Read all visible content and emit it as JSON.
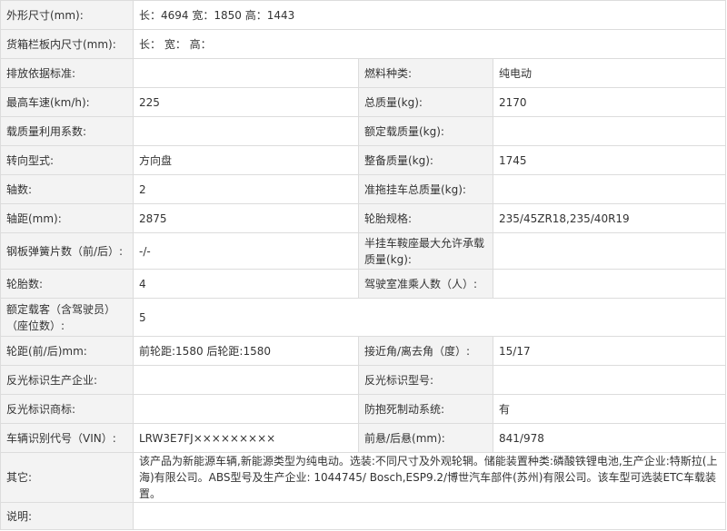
{
  "rows": [
    {
      "l1": "外形尺寸(mm):",
      "v1": "长：4694 宽：1850 高：1443",
      "full": true
    },
    {
      "l1": "货箱栏板内尺寸(mm):",
      "v1": "长： 宽： 高：",
      "full": true
    },
    {
      "l1": "排放依据标准:",
      "v1": "",
      "l2": "燃料种类:",
      "v2": "纯电动"
    },
    {
      "l1": "最高车速(km/h):",
      "v1": "225",
      "l2": "总质量(kg):",
      "v2": "2170"
    },
    {
      "l1": "载质量利用系数:",
      "v1": "",
      "l2": "额定载质量(kg):",
      "v2": ""
    },
    {
      "l1": "转向型式:",
      "v1": "方向盘",
      "l2": "整备质量(kg):",
      "v2": "1745"
    },
    {
      "l1": "轴数:",
      "v1": "2",
      "l2": "准拖挂车总质量(kg):",
      "v2": ""
    },
    {
      "l1": "轴距(mm):",
      "v1": "2875",
      "l2": "轮胎规格:",
      "v2": "235/45ZR18,235/40R19"
    },
    {
      "l1": "钢板弹簧片数（前/后）:",
      "v1": "-/-",
      "l2": "半挂车鞍座最大允许承载质量(kg):",
      "v2": ""
    },
    {
      "l1": "轮胎数:",
      "v1": "4",
      "l2": "驾驶室准乘人数（人）:",
      "v2": ""
    },
    {
      "l1": "额定载客（含驾驶员）（座位数）:",
      "v1": "5",
      "full": true
    },
    {
      "l1": "轮距(前/后)mm:",
      "v1": "前轮距:1580 后轮距:1580",
      "l2": "接近角/离去角（度）:",
      "v2": "15/17"
    },
    {
      "l1": "反光标识生产企业:",
      "v1": "",
      "l2": "反光标识型号:",
      "v2": ""
    },
    {
      "l1": "反光标识商标:",
      "v1": "",
      "l2": "防抱死制动系统:",
      "v2": "有"
    },
    {
      "l1": "车辆识别代号（VIN）:",
      "v1": "LRW3E7FJ×××××××××",
      "l2": "前悬/后悬(mm):",
      "v2": "841/978"
    },
    {
      "l1": "其它:",
      "v1": "该产品为新能源车辆,新能源类型为纯电动。选装:不同尺寸及外观轮辋。储能装置种类:磷酸铁锂电池,生产企业:特斯拉(上海)有限公司。ABS型号及生产企业: 1044745/ Bosch,ESP9.2/博世汽车部件(苏州)有限公司。该车型可选装ETC车载装置。",
      "full": true
    },
    {
      "l1": "说明:",
      "v1": "",
      "full": true
    }
  ]
}
